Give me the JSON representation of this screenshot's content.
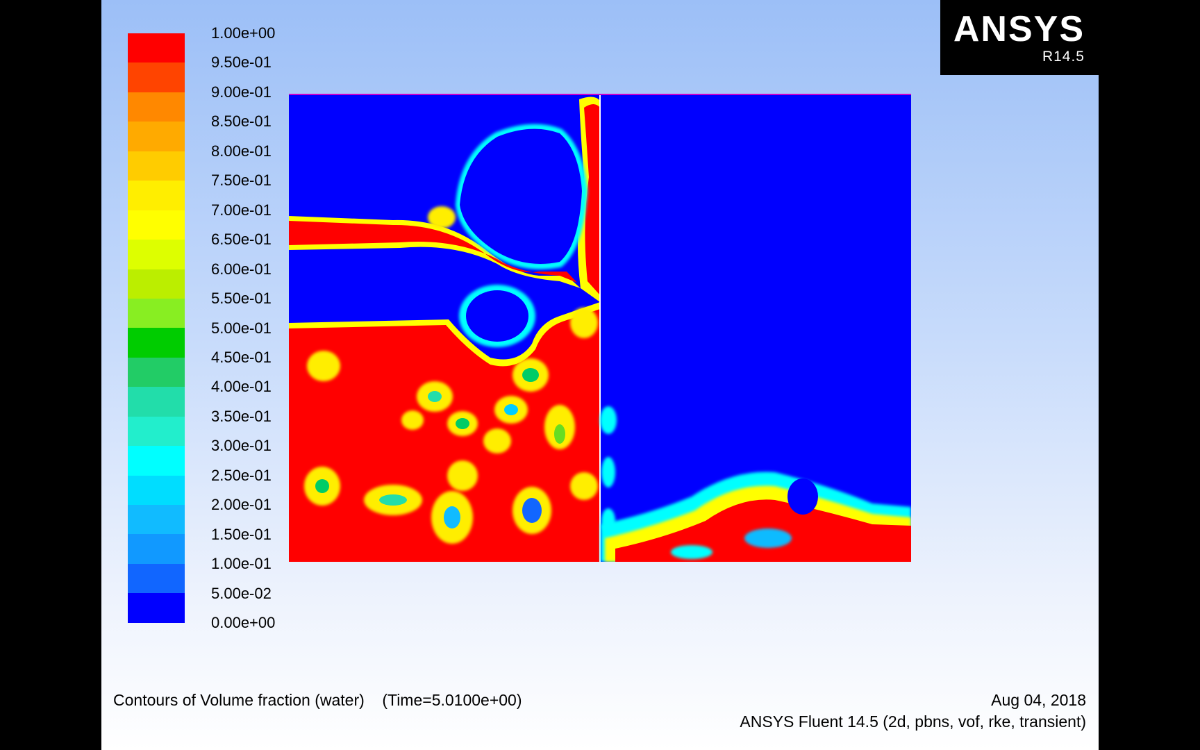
{
  "logo": {
    "brand": "ANSYS",
    "release": "R14.5"
  },
  "legend": {
    "labels": [
      "1.00e+00",
      "9.50e-01",
      "9.00e-01",
      "8.50e-01",
      "8.00e-01",
      "7.50e-01",
      "7.00e-01",
      "6.50e-01",
      "6.00e-01",
      "5.50e-01",
      "5.00e-01",
      "4.50e-01",
      "4.00e-01",
      "3.50e-01",
      "3.00e-01",
      "2.50e-01",
      "2.00e-01",
      "1.50e-01",
      "1.00e-01",
      "5.00e-02",
      "0.00e+00"
    ],
    "colors": [
      "#ff0000",
      "#ff4400",
      "#ff8800",
      "#ffaa00",
      "#ffcc00",
      "#ffee00",
      "#ffff00",
      "#ddff00",
      "#bbee00",
      "#88ee22",
      "#00cc00",
      "#22cc66",
      "#22ddaa",
      "#22eecc",
      "#00ffff",
      "#00ddff",
      "#11bbff",
      "#1199ff",
      "#1166ff",
      "#0000ff"
    ]
  },
  "footer": {
    "title": "Contours of Volume fraction (water)",
    "time": "(Time=5.0100e+00)",
    "date": "Aug 04, 2018",
    "solver": "ANSYS Fluent 14.5 (2d, pbns, vof, rke, transient)"
  }
}
